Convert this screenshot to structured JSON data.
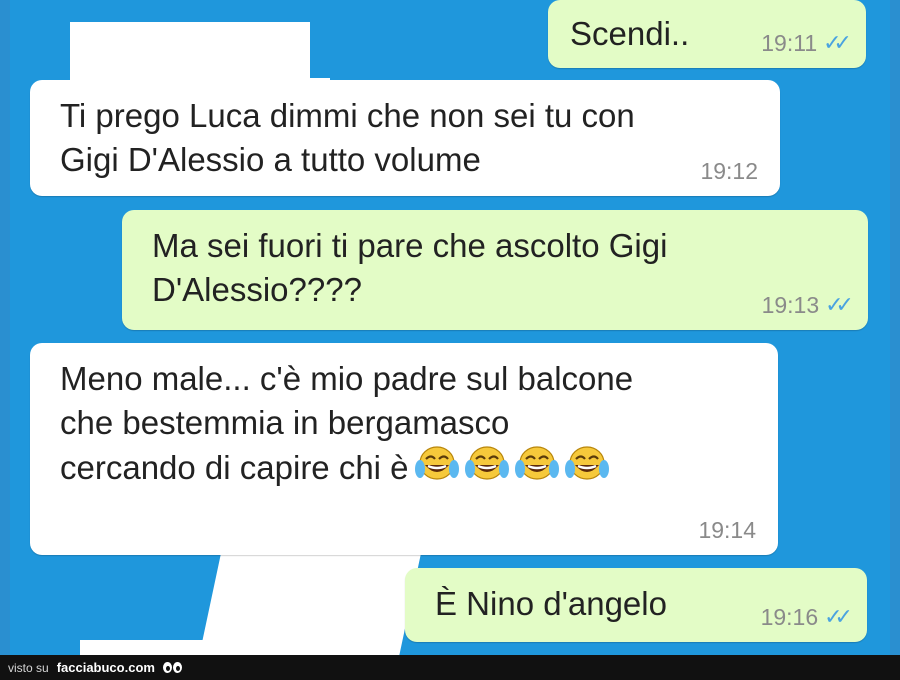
{
  "messages": [
    {
      "direction": "outgoing",
      "text": "Scendi..",
      "time": "19:11",
      "read": true
    },
    {
      "direction": "incoming",
      "text": "Ti prego Luca dimmi che non sei tu con\nGigi D'Alessio a tutto volume",
      "time": "19:12"
    },
    {
      "direction": "outgoing",
      "text": "Ma sei fuori ti pare che ascolto Gigi\nD'Alessio????",
      "time": "19:13",
      "read": true
    },
    {
      "direction": "incoming",
      "text": "Meno male... c'è mio padre sul balcone\nche bestemmia in bergamasco\ncercando di capire chi è",
      "emoji": [
        "face-with-tears-of-joy-icon",
        "face-with-tears-of-joy-icon",
        "face-with-tears-of-joy-icon",
        "face-with-tears-of-joy-icon"
      ],
      "time": "19:14"
    },
    {
      "direction": "outgoing",
      "text": "È Nino d'angelo",
      "time": "19:16",
      "read": true
    }
  ],
  "footer": {
    "prefix": "visto su",
    "site": "facciabuco.com"
  },
  "colors": {
    "wallpaper": "#1f97dc",
    "incoming_bubble": "#ffffff",
    "outgoing_bubble": "#e3fcc6",
    "read_ticks": "#4aa3e0"
  }
}
